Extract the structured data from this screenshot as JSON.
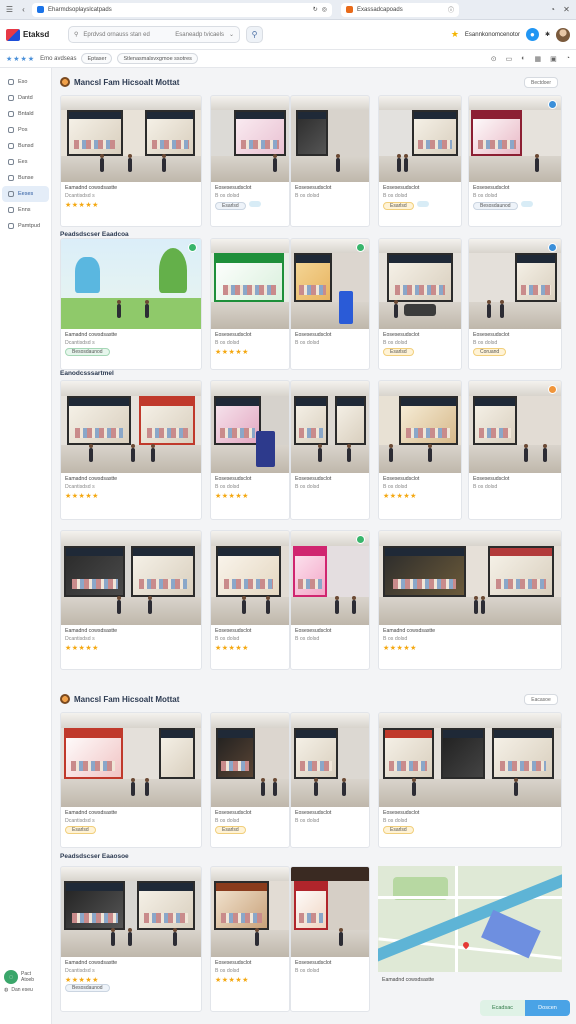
{
  "browser": {
    "tab1_title": "Eharmdsoplayslcatpads",
    "tab2_title": "Exassadcapoads",
    "nav_back": "‹",
    "nav_refresh": "↻",
    "nav_close": "✕"
  },
  "app": {
    "name": "Etaksd",
    "search_placeholder": "Eprdvsd ornauss stan ed",
    "search_hint": "Esaneadp tvicaels",
    "header_right_text": "Esannkonomcenotor",
    "brand_color": "#2c5aa0"
  },
  "subbar": {
    "stars": "★★★★",
    "label": "Emo avdseas",
    "chips": [
      "Eptaser",
      "Stlenasmalsvxgmoe ssotres"
    ]
  },
  "sidebar": {
    "items": [
      {
        "label": "Eso",
        "active": false
      },
      {
        "label": "Dantd",
        "active": false
      },
      {
        "label": "Bntald",
        "active": false
      },
      {
        "label": "Pos",
        "active": false
      },
      {
        "label": "Bunsd",
        "active": false
      },
      {
        "label": "Ees",
        "active": false
      },
      {
        "label": "Bunse",
        "active": false
      },
      {
        "label": "Eeses",
        "active": true
      },
      {
        "label": "Enns",
        "active": false
      },
      {
        "label": "Pamtpud",
        "active": false
      }
    ],
    "bottom_label_1": "Pact",
    "bottom_label_2": "Atoeb",
    "bottom_label_3": "Dan eseu"
  },
  "section1": {
    "title": "Mancsl Fam Hicsoalt Mottat",
    "button": "Bectdoer",
    "group2_label": "Peadsdscser  Eaadcoa",
    "group3_label": "Eanodcsssartmel"
  },
  "section2": {
    "title": "Mancsl Fam Hicsoalt Mottat",
    "button": "Eacasoe",
    "group2_label": "Peadsdscser  Eaaosoe"
  },
  "cards": {
    "title_a": "Eamadnd cowsdsastte",
    "title_b": "Eosesesudsclot",
    "sub_a": "Dcantisdsd s",
    "sub_b": "B os dolsd",
    "rating": "★★★★★",
    "pill_a": "Esarlsd",
    "pill_b": "Besosdaunod",
    "pill_c": "Coruand"
  },
  "fab": {
    "left": "Ecadsac",
    "right": "Doscen"
  }
}
